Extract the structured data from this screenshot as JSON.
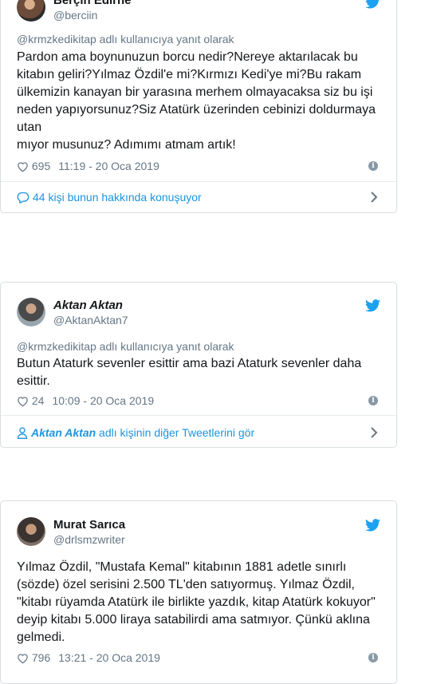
{
  "tweets": [
    {
      "name": "Berçin Edirne",
      "handle": "@berciin",
      "reply_to": "@krmzkedikitap adlı kullanıcıya yanıt olarak",
      "text": "Pardon ama boynunuzun borcu nedir?Nereye aktarılacak bu kitabın geliri?Yılmaz Özdil'e mi?Kırmızı Kedi'ye mi?Bu rakam ülkemizin kanayan bir yarasına merhem olmayacaksa siz bu işi neden yapıyorsunuz?Siz Atatürk üzerinden cebinizi doldurmaya utan\nmıyor musunuz? Adımımı atmam artık!",
      "likes": "695",
      "time": "11:19 - 20 Oca 2019",
      "footer_icon": "speech-bubble-icon",
      "footer_text": "44 kişi bunun hakkında konuşuyor"
    },
    {
      "name": "Aktan Aktan",
      "handle": "@AktanAktan7",
      "reply_to": "@krmzkedikitap adlı kullanıcıya yanıt olarak",
      "text": "Butun Ataturk sevenler esittir ama bazi Ataturk sevenler daha esittir.",
      "likes": "24",
      "time": "10:09 - 20 Oca 2019",
      "footer_icon": "person-icon",
      "footer_name": "Aktan Aktan",
      "footer_text": " adlı kişinin diğer Tweetlerini gör"
    },
    {
      "name": "Murat Sarıca",
      "handle": "@drlsmzwriter",
      "text": "Yılmaz Özdil, \"Mustafa Kemal\" kitabının 1881 adetle sınırlı (sözde) özel serisini 2.500 TL'den satıyormuş. Yılmaz Özdil, \"kitabı rüyamda Atatürk ile birlikte yazdık, kitap Atatürk kokuyor\" deyip kitabı 5.000 liraya satabilirdi ama satmıyor. Çünkü aklına gelmedi.",
      "likes": "796",
      "time": "13:21 - 20 Oca 2019"
    }
  ],
  "colors": {
    "link": "#1b95e0",
    "muted": "#657786",
    "border": "#d8dee2",
    "bird": "#1da1f2"
  },
  "icons": [
    "twitter-bird-icon",
    "heart-icon",
    "info-icon",
    "chevron-right-icon"
  ]
}
